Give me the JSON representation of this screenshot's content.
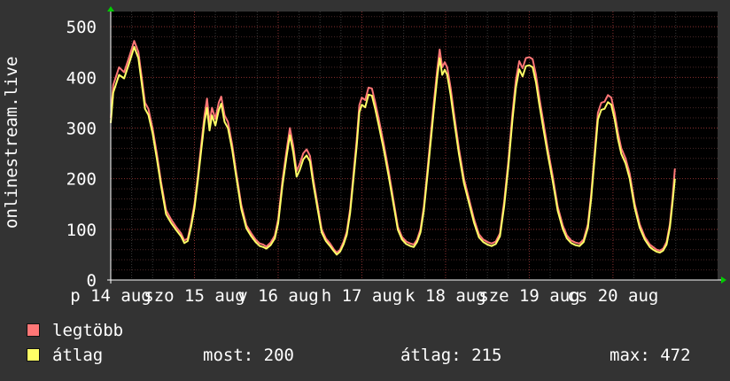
{
  "chart_data": {
    "type": "line",
    "ylabel": "onlinestream.live",
    "ylim": [
      0,
      530
    ],
    "yticks": [
      0,
      100,
      200,
      300,
      400,
      500
    ],
    "grid": true,
    "xlim": [
      0,
      7.25
    ],
    "xticks": [
      {
        "label": "p 14 aug",
        "x": 0
      },
      {
        "label": "szo 15 aug",
        "x": 1
      },
      {
        "label": "v 16 aug",
        "x": 2
      },
      {
        "label": "h 17 aug",
        "x": 3
      },
      {
        "label": "k 18 aug",
        "x": 4
      },
      {
        "label": "sze 19 aug",
        "x": 5
      },
      {
        "label": "cs 20 aug",
        "x": 6
      }
    ],
    "series": [
      {
        "name": "legtöbb",
        "color": "#ff7777",
        "points": [
          [
            0,
            320
          ],
          [
            0.03,
            385
          ],
          [
            0.1,
            420
          ],
          [
            0.16,
            410
          ],
          [
            0.22,
            440
          ],
          [
            0.28,
            472
          ],
          [
            0.33,
            450
          ],
          [
            0.37,
            400
          ],
          [
            0.41,
            350
          ],
          [
            0.45,
            338
          ],
          [
            0.5,
            300
          ],
          [
            0.55,
            250
          ],
          [
            0.6,
            195
          ],
          [
            0.66,
            138
          ],
          [
            0.72,
            120
          ],
          [
            0.78,
            105
          ],
          [
            0.84,
            92
          ],
          [
            0.88,
            78
          ],
          [
            0.92,
            82
          ],
          [
            0.96,
            112
          ],
          [
            1.0,
            150
          ],
          [
            1.04,
            205
          ],
          [
            1.08,
            265
          ],
          [
            1.12,
            325
          ],
          [
            1.15,
            358
          ],
          [
            1.18,
            310
          ],
          [
            1.21,
            340
          ],
          [
            1.25,
            318
          ],
          [
            1.29,
            350
          ],
          [
            1.32,
            362
          ],
          [
            1.36,
            325
          ],
          [
            1.4,
            312
          ],
          [
            1.45,
            268
          ],
          [
            1.5,
            212
          ],
          [
            1.56,
            148
          ],
          [
            1.62,
            108
          ],
          [
            1.68,
            92
          ],
          [
            1.73,
            80
          ],
          [
            1.78,
            72
          ],
          [
            1.82,
            70
          ],
          [
            1.86,
            66
          ],
          [
            1.91,
            74
          ],
          [
            1.96,
            88
          ],
          [
            2.0,
            120
          ],
          [
            2.05,
            195
          ],
          [
            2.1,
            255
          ],
          [
            2.14,
            300
          ],
          [
            2.18,
            265
          ],
          [
            2.22,
            215
          ],
          [
            2.26,
            230
          ],
          [
            2.3,
            250
          ],
          [
            2.34,
            258
          ],
          [
            2.38,
            245
          ],
          [
            2.42,
            200
          ],
          [
            2.48,
            140
          ],
          [
            2.52,
            100
          ],
          [
            2.57,
            82
          ],
          [
            2.62,
            72
          ],
          [
            2.66,
            62
          ],
          [
            2.7,
            54
          ],
          [
            2.74,
            60
          ],
          [
            2.78,
            75
          ],
          [
            2.82,
            95
          ],
          [
            2.86,
            140
          ],
          [
            2.9,
            210
          ],
          [
            2.94,
            280
          ],
          [
            2.97,
            345
          ],
          [
            3.0,
            360
          ],
          [
            3.04,
            355
          ],
          [
            3.08,
            380
          ],
          [
            3.12,
            378
          ],
          [
            3.16,
            350
          ],
          [
            3.2,
            320
          ],
          [
            3.26,
            270
          ],
          [
            3.32,
            215
          ],
          [
            3.38,
            155
          ],
          [
            3.43,
            105
          ],
          [
            3.48,
            85
          ],
          [
            3.53,
            76
          ],
          [
            3.58,
            72
          ],
          [
            3.62,
            70
          ],
          [
            3.66,
            80
          ],
          [
            3.7,
            100
          ],
          [
            3.74,
            145
          ],
          [
            3.78,
            210
          ],
          [
            3.82,
            280
          ],
          [
            3.86,
            350
          ],
          [
            3.9,
            415
          ],
          [
            3.93,
            455
          ],
          [
            3.96,
            420
          ],
          [
            3.99,
            430
          ],
          [
            4.02,
            420
          ],
          [
            4.06,
            380
          ],
          [
            4.1,
            330
          ],
          [
            4.16,
            260
          ],
          [
            4.22,
            200
          ],
          [
            4.28,
            160
          ],
          [
            4.34,
            120
          ],
          [
            4.4,
            90
          ],
          [
            4.45,
            80
          ],
          [
            4.5,
            75
          ],
          [
            4.55,
            72
          ],
          [
            4.6,
            76
          ],
          [
            4.65,
            92
          ],
          [
            4.7,
            155
          ],
          [
            4.75,
            235
          ],
          [
            4.8,
            330
          ],
          [
            4.84,
            395
          ],
          [
            4.88,
            432
          ],
          [
            4.92,
            418
          ],
          [
            4.96,
            438
          ],
          [
            5.0,
            440
          ],
          [
            5.04,
            436
          ],
          [
            5.08,
            405
          ],
          [
            5.12,
            360
          ],
          [
            5.17,
            310
          ],
          [
            5.22,
            260
          ],
          [
            5.28,
            205
          ],
          [
            5.34,
            145
          ],
          [
            5.4,
            108
          ],
          [
            5.45,
            88
          ],
          [
            5.5,
            78
          ],
          [
            5.55,
            74
          ],
          [
            5.6,
            72
          ],
          [
            5.65,
            80
          ],
          [
            5.7,
            110
          ],
          [
            5.74,
            170
          ],
          [
            5.78,
            250
          ],
          [
            5.82,
            330
          ],
          [
            5.86,
            350
          ],
          [
            5.9,
            352
          ],
          [
            5.94,
            365
          ],
          [
            5.98,
            360
          ],
          [
            6.02,
            330
          ],
          [
            6.06,
            290
          ],
          [
            6.1,
            260
          ],
          [
            6.15,
            240
          ],
          [
            6.2,
            210
          ],
          [
            6.26,
            150
          ],
          [
            6.32,
            110
          ],
          [
            6.38,
            85
          ],
          [
            6.44,
            70
          ],
          [
            6.48,
            65
          ],
          [
            6.52,
            60
          ],
          [
            6.56,
            58
          ],
          [
            6.6,
            62
          ],
          [
            6.64,
            75
          ],
          [
            6.68,
            110
          ],
          [
            6.71,
            160
          ],
          [
            6.74,
            220
          ]
        ]
      },
      {
        "name": "átlag",
        "color": "#ffff66",
        "points": [
          [
            0,
            310
          ],
          [
            0.03,
            370
          ],
          [
            0.1,
            405
          ],
          [
            0.16,
            398
          ],
          [
            0.22,
            428
          ],
          [
            0.28,
            460
          ],
          [
            0.33,
            438
          ],
          [
            0.37,
            388
          ],
          [
            0.41,
            338
          ],
          [
            0.45,
            326
          ],
          [
            0.5,
            290
          ],
          [
            0.55,
            240
          ],
          [
            0.6,
            187
          ],
          [
            0.66,
            130
          ],
          [
            0.72,
            113
          ],
          [
            0.78,
            99
          ],
          [
            0.84,
            86
          ],
          [
            0.88,
            73
          ],
          [
            0.92,
            77
          ],
          [
            0.96,
            105
          ],
          [
            1.0,
            142
          ],
          [
            1.04,
            196
          ],
          [
            1.08,
            254
          ],
          [
            1.12,
            312
          ],
          [
            1.15,
            340
          ],
          [
            1.18,
            295
          ],
          [
            1.21,
            325
          ],
          [
            1.25,
            305
          ],
          [
            1.29,
            335
          ],
          [
            1.32,
            348
          ],
          [
            1.36,
            312
          ],
          [
            1.4,
            300
          ],
          [
            1.45,
            258
          ],
          [
            1.5,
            203
          ],
          [
            1.56,
            140
          ],
          [
            1.62,
            102
          ],
          [
            1.68,
            86
          ],
          [
            1.73,
            75
          ],
          [
            1.78,
            67
          ],
          [
            1.82,
            65
          ],
          [
            1.86,
            62
          ],
          [
            1.91,
            69
          ],
          [
            1.96,
            82
          ],
          [
            2.0,
            112
          ],
          [
            2.05,
            185
          ],
          [
            2.1,
            243
          ],
          [
            2.14,
            286
          ],
          [
            2.18,
            252
          ],
          [
            2.22,
            204
          ],
          [
            2.26,
            218
          ],
          [
            2.3,
            238
          ],
          [
            2.34,
            246
          ],
          [
            2.38,
            234
          ],
          [
            2.42,
            190
          ],
          [
            2.48,
            132
          ],
          [
            2.52,
            94
          ],
          [
            2.57,
            77
          ],
          [
            2.62,
            67
          ],
          [
            2.66,
            58
          ],
          [
            2.7,
            50
          ],
          [
            2.74,
            56
          ],
          [
            2.78,
            70
          ],
          [
            2.82,
            89
          ],
          [
            2.86,
            132
          ],
          [
            2.9,
            200
          ],
          [
            2.94,
            268
          ],
          [
            2.97,
            331
          ],
          [
            3.0,
            346
          ],
          [
            3.04,
            341
          ],
          [
            3.08,
            366
          ],
          [
            3.12,
            364
          ],
          [
            3.16,
            337
          ],
          [
            3.2,
            307
          ],
          [
            3.26,
            259
          ],
          [
            3.32,
            205
          ],
          [
            3.38,
            147
          ],
          [
            3.43,
            99
          ],
          [
            3.48,
            80
          ],
          [
            3.53,
            71
          ],
          [
            3.58,
            67
          ],
          [
            3.62,
            65
          ],
          [
            3.66,
            75
          ],
          [
            3.7,
            94
          ],
          [
            3.74,
            137
          ],
          [
            3.78,
            200
          ],
          [
            3.82,
            268
          ],
          [
            3.86,
            336
          ],
          [
            3.9,
            400
          ],
          [
            3.93,
            438
          ],
          [
            3.96,
            405
          ],
          [
            3.99,
            415
          ],
          [
            4.02,
            405
          ],
          [
            4.06,
            366
          ],
          [
            4.1,
            317
          ],
          [
            4.16,
            249
          ],
          [
            4.22,
            191
          ],
          [
            4.28,
            152
          ],
          [
            4.34,
            113
          ],
          [
            4.4,
            84
          ],
          [
            4.45,
            75
          ],
          [
            4.5,
            70
          ],
          [
            4.55,
            67
          ],
          [
            4.6,
            71
          ],
          [
            4.65,
            86
          ],
          [
            4.7,
            146
          ],
          [
            4.75,
            224
          ],
          [
            4.8,
            317
          ],
          [
            4.84,
            380
          ],
          [
            4.88,
            416
          ],
          [
            4.92,
            402
          ],
          [
            4.96,
            422
          ],
          [
            5.0,
            424
          ],
          [
            5.04,
            420
          ],
          [
            5.08,
            390
          ],
          [
            5.12,
            346
          ],
          [
            5.17,
            297
          ],
          [
            5.22,
            249
          ],
          [
            5.28,
            195
          ],
          [
            5.34,
            137
          ],
          [
            5.4,
            101
          ],
          [
            5.45,
            82
          ],
          [
            5.5,
            73
          ],
          [
            5.55,
            69
          ],
          [
            5.6,
            67
          ],
          [
            5.65,
            75
          ],
          [
            5.7,
            103
          ],
          [
            5.74,
            161
          ],
          [
            5.78,
            239
          ],
          [
            5.82,
            317
          ],
          [
            5.86,
            336
          ],
          [
            5.9,
            338
          ],
          [
            5.94,
            351
          ],
          [
            5.98,
            346
          ],
          [
            6.02,
            317
          ],
          [
            6.06,
            278
          ],
          [
            6.1,
            249
          ],
          [
            6.15,
            230
          ],
          [
            6.2,
            200
          ],
          [
            6.26,
            142
          ],
          [
            6.32,
            103
          ],
          [
            6.38,
            80
          ],
          [
            6.44,
            65
          ],
          [
            6.48,
            60
          ],
          [
            6.52,
            56
          ],
          [
            6.56,
            54
          ],
          [
            6.6,
            58
          ],
          [
            6.64,
            70
          ],
          [
            6.68,
            103
          ],
          [
            6.71,
            150
          ],
          [
            6.74,
            200
          ]
        ]
      }
    ]
  },
  "legend": {
    "max_label": "legtöbb",
    "avg_label": "átlag"
  },
  "stats": {
    "now": "most: 200",
    "avg": "átlag: 215",
    "max": "max: 472"
  }
}
